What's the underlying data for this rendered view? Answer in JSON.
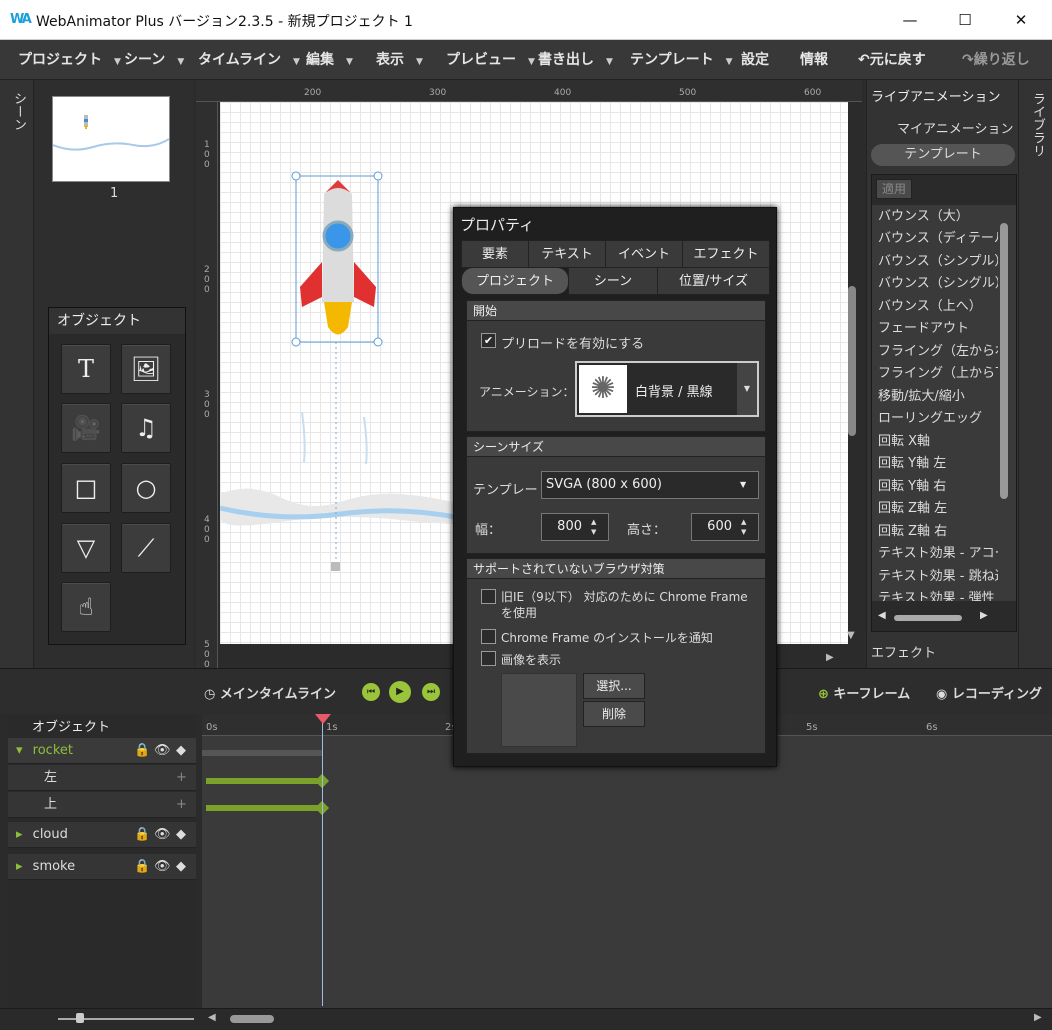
{
  "app": {
    "logo": "WA",
    "title": "WebAnimator Plus バージョン2.3.5 - 新規プロジェクト 1"
  },
  "window": {
    "minimize": "—",
    "maximize": "☐",
    "close": "✕"
  },
  "menu": {
    "items": [
      "プロジェクト",
      "シーン",
      "タイムライン",
      "編集",
      "表示",
      "プレビュー",
      "書き出し",
      "テンプレート"
    ],
    "settings": "設定",
    "info": "情報",
    "undo": "元に戻す",
    "redo": "繰り返し"
  },
  "scene": {
    "strip_label": "シーン",
    "thumb_number": "1"
  },
  "objects": {
    "title": "オブジェクト",
    "tools": [
      "text-tool",
      "image-tool",
      "video-tool",
      "audio-tool",
      "rectangle-tool",
      "circle-tool",
      "triangle-tool",
      "line-tool",
      "hand-tool"
    ]
  },
  "ruler": {
    "top": [
      "200",
      "300",
      "400",
      "500",
      "600"
    ],
    "left": [
      "1\n0\n0",
      "2\n0\n0",
      "3\n0\n0",
      "4\n0\n0",
      "5\n0\n0"
    ]
  },
  "library": {
    "strip_label": "ライブラリ",
    "header": "ライブアニメーション",
    "my_animation": "マイアニメーション",
    "template": "テンプレート",
    "apply": "適用",
    "items": [
      "バウンス（大）",
      "バウンス（ディテール）",
      "バウンス（シンプル）",
      "バウンス（シングル）",
      "バウンス（上へ）",
      "フェードアウト",
      "フライング（左から右）",
      "フライング（上から下）",
      "移動/拡大/縮小",
      "ローリングエッグ",
      "回転 X軸",
      "回転 Y軸 左",
      "回転 Y軸 右",
      "回転 Z軸 左",
      "回転 Z軸 右",
      "テキスト効果 - アコーデ",
      "テキスト効果 - 跳ね返",
      "テキスト効果 - 弾性"
    ],
    "effect": "エフェクト"
  },
  "props": {
    "title": "プロパティ",
    "tabs_row1": [
      "要素",
      "テキスト",
      "イベント",
      "エフェクト"
    ],
    "tabs_row2": [
      "プロジェクト",
      "シーン",
      "位置/サイズ"
    ],
    "start": {
      "header": "開始",
      "preload": "プリロードを有効にする",
      "preload_checked": true,
      "animation_label": "アニメーション：",
      "animation_value": "白背景 / 黒線"
    },
    "scene_size": {
      "header": "シーンサイズ",
      "template_label": "テンプレート",
      "template_value": "SVGA (800 x 600)",
      "width_label": "幅：",
      "width_value": "800",
      "height_label": "高さ：",
      "height_value": "600"
    },
    "unsupported": {
      "header": "サポートされていないブラウザ対策",
      "opt1_line1": "旧IE（9以下） 対応のために Chrome Frame",
      "opt1_line2": "を使用",
      "opt2": "Chrome Frame のインストールを通知",
      "opt3": "画像を表示",
      "select": "選択...",
      "delete": "削除"
    }
  },
  "timeline": {
    "main": "メインタイムライン",
    "keyframe": "キーフレーム",
    "recording": "レコーディング",
    "objects_header": "オブジェクト",
    "layers": [
      {
        "name": "rocket",
        "color": "#8fbf3a"
      },
      {
        "name": "左"
      },
      {
        "name": "上"
      },
      {
        "name": "cloud"
      },
      {
        "name": "smoke"
      }
    ],
    "ticks": [
      "0s",
      "1s",
      "2s",
      "5s",
      "6s"
    ]
  }
}
